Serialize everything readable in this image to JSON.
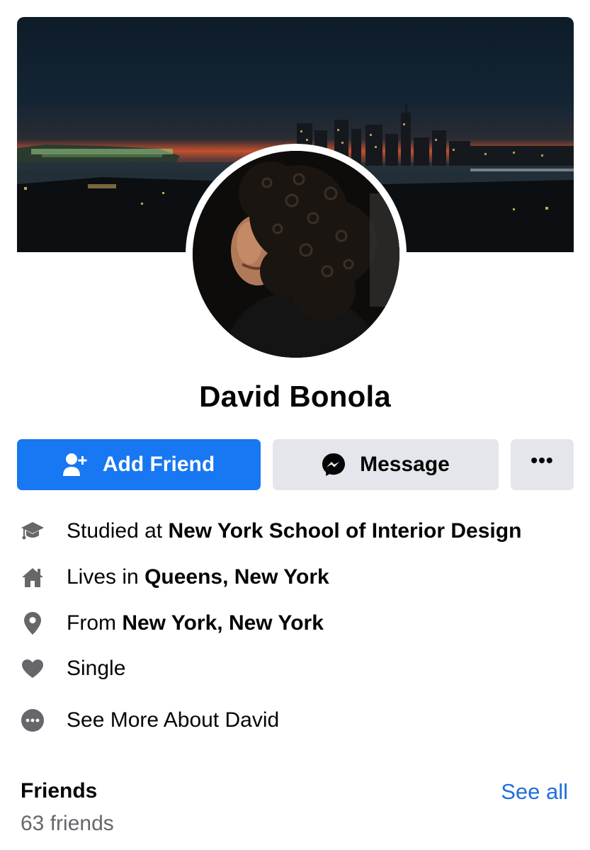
{
  "profile": {
    "name": "David Bonola"
  },
  "actions": {
    "add_friend_label": "Add Friend",
    "message_label": "Message",
    "more_label": "•••"
  },
  "about": {
    "education_prefix": "Studied at ",
    "education_value": "New York School of Interior Design",
    "lives_prefix": "Lives in ",
    "lives_value": "Queens, New York",
    "from_prefix": "From ",
    "from_value": "New York, New York",
    "relationship": "Single",
    "see_more": "See More About David"
  },
  "friends": {
    "title": "Friends",
    "see_all": "See all",
    "count": "63 friends"
  },
  "icons": {
    "education": "graduation-cap-icon",
    "home": "home-icon",
    "location": "location-pin-icon",
    "relationship": "heart-icon",
    "more": "more-dots-icon",
    "add_friend": "add-person-icon",
    "message": "messenger-icon"
  },
  "colors": {
    "primary": "#1877f2",
    "secondary_button": "#e4e6eb",
    "link": "#216fdb",
    "muted_text": "#65676b",
    "icon": "#65676b"
  }
}
